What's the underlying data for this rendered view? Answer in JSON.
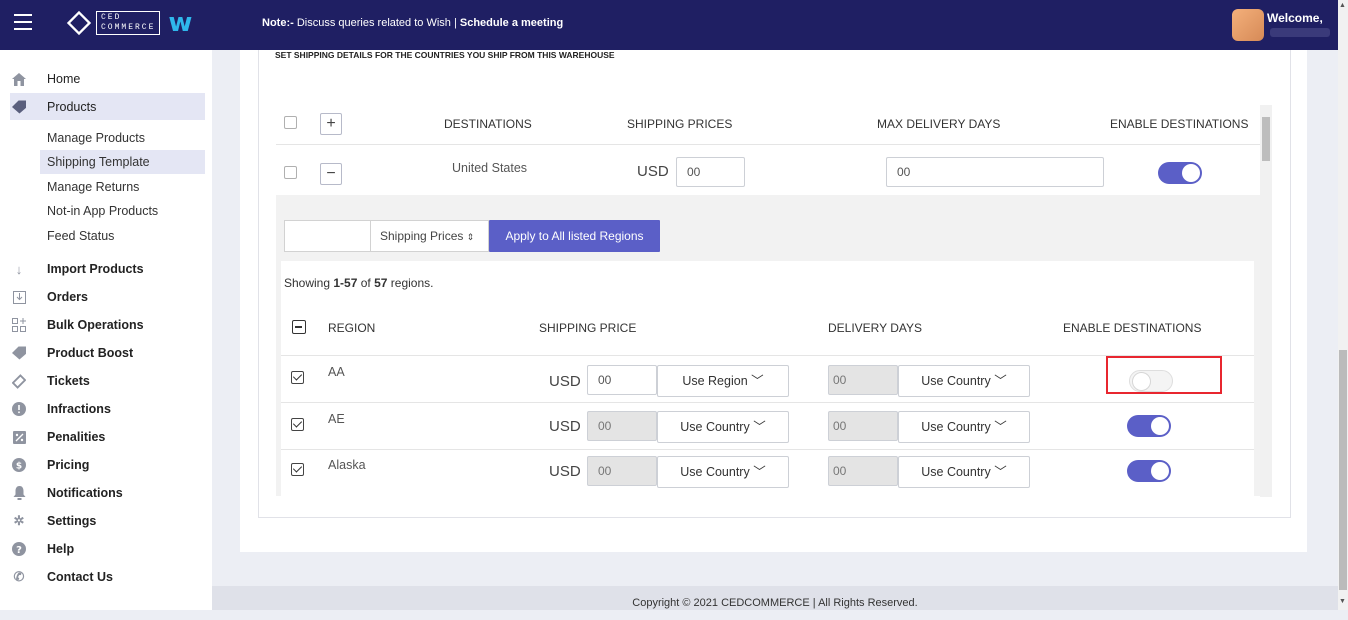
{
  "topbar": {
    "note_prefix": "Note:-",
    "note_text": " Discuss queries related to Wish | ",
    "note_link": "Schedule a meeting",
    "welcome": "Welcome,",
    "logo_text_top": "CED",
    "logo_text_bottom": "COMMERCE",
    "logo_w": "w"
  },
  "sidebar": {
    "items": [
      {
        "label": "Home",
        "icon": "home-icon"
      },
      {
        "label": "Products",
        "icon": "tag-icon"
      },
      {
        "label": "Import Products",
        "icon": "arrow-down-icon"
      },
      {
        "label": "Orders",
        "icon": "orders-icon"
      },
      {
        "label": "Bulk Operations",
        "icon": "grid-plus-icon"
      },
      {
        "label": "Product Boost",
        "icon": "tag-icon"
      },
      {
        "label": "Tickets",
        "icon": "ticket-icon"
      },
      {
        "label": "Infractions",
        "icon": "alert-icon"
      },
      {
        "label": "Penalities",
        "icon": "percent-icon"
      },
      {
        "label": "Pricing",
        "icon": "dollar-icon"
      },
      {
        "label": "Notifications",
        "icon": "bell-icon"
      },
      {
        "label": "Settings",
        "icon": "gear-icon"
      },
      {
        "label": "Help",
        "icon": "help-icon"
      },
      {
        "label": "Contact Us",
        "icon": "phone-icon"
      }
    ],
    "sub_items": [
      "Manage Products",
      "Shipping Template",
      "Manage Returns",
      "Not-in App Products",
      "Feed Status"
    ]
  },
  "main": {
    "section_title": "SET SHIPPING DETAILS FOR THE COUNTRIES YOU SHIP FROM THIS WAREHOUSE",
    "dest_headers": {
      "destinations": "DESTINATIONS",
      "shipping_prices": "SHIPPING PRICES",
      "max_delivery": "MAX DELIVERY DAYS",
      "enable": "ENABLE DESTINATIONS"
    },
    "dest_row": {
      "country": "United States",
      "currency": "USD",
      "price": "00",
      "days": "00",
      "enabled": true
    },
    "apply": {
      "select_label": "Shipping Prices",
      "button": "Apply to All listed Regions"
    },
    "showing": {
      "prefix": "Showing ",
      "range": "1-57",
      "mid": " of ",
      "total": "57",
      "suffix": " regions."
    },
    "region_headers": {
      "region": "REGION",
      "price": "SHIPPING PRICE",
      "days": "DELIVERY DAYS",
      "enable": "ENABLE DESTINATIONS"
    },
    "regions": [
      {
        "name": "AA",
        "currency": "USD",
        "price": "00",
        "price_mode": "Use Region",
        "days": "00",
        "days_mode": "Use Country",
        "enabled": false
      },
      {
        "name": "AE",
        "currency": "USD",
        "price": "00",
        "price_mode": "Use Country",
        "days": "00",
        "days_mode": "Use Country",
        "enabled": true
      },
      {
        "name": "Alaska",
        "currency": "USD",
        "price": "00",
        "price_mode": "Use Country",
        "days": "00",
        "days_mode": "Use Country",
        "enabled": true
      }
    ]
  },
  "footer": {
    "copyright": "Copyright © 2021 CEDCOMMERCE | All Rights Reserved."
  },
  "colors": {
    "topbar": "#1f1f63",
    "accent": "#5b5fc7",
    "highlight": "#e8262f"
  }
}
